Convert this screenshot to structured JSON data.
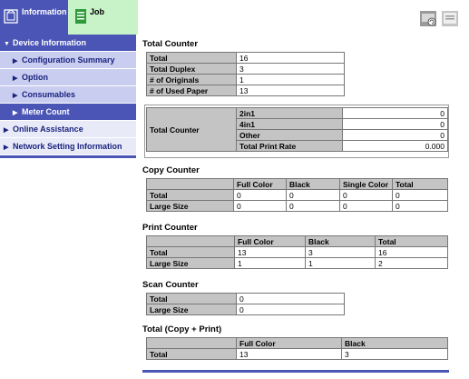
{
  "tabs": {
    "information": "Information",
    "job": "Job"
  },
  "sidebar": {
    "device_information": "Device Information",
    "configuration_summary": "Configuration Summary",
    "option": "Option",
    "consumables": "Consumables",
    "meter_count": "Meter Count",
    "online_assistance": "Online Assistance",
    "network_setting_information": "Network Setting Information"
  },
  "total_counter": {
    "title": "Total Counter",
    "rows": [
      {
        "label": "Total",
        "value": "16"
      },
      {
        "label": "Total Duplex",
        "value": "3"
      },
      {
        "label": "# of Originals",
        "value": "1"
      },
      {
        "label": "# of Used Paper",
        "value": "13"
      }
    ],
    "box_label": "Total Counter",
    "box_rows": [
      {
        "label": "2in1",
        "value": "0"
      },
      {
        "label": "4in1",
        "value": "0"
      },
      {
        "label": "Other",
        "value": "0"
      },
      {
        "label": "Total Print Rate",
        "value": "0.000"
      }
    ]
  },
  "copy_counter": {
    "title": "Copy Counter",
    "headers": [
      "Full Color",
      "Black",
      "Single Color",
      "Total"
    ],
    "rows": [
      {
        "label": "Total",
        "values": [
          "0",
          "0",
          "0",
          "0"
        ]
      },
      {
        "label": "Large Size",
        "values": [
          "0",
          "0",
          "0",
          "0"
        ]
      }
    ]
  },
  "print_counter": {
    "title": "Print Counter",
    "headers": [
      "Full Color",
      "Black",
      "Total"
    ],
    "rows": [
      {
        "label": "Total",
        "values": [
          "13",
          "3",
          "16"
        ]
      },
      {
        "label": "Large Size",
        "values": [
          "1",
          "1",
          "2"
        ]
      }
    ]
  },
  "scan_counter": {
    "title": "Scan Counter",
    "rows": [
      {
        "label": "Total",
        "value": "0"
      },
      {
        "label": "Large Size",
        "value": "0"
      }
    ]
  },
  "total_copy_print": {
    "title": "Total (Copy + Print)",
    "headers": [
      "Full Color",
      "Black"
    ],
    "rows": [
      {
        "label": "Total",
        "values": [
          "13",
          "3"
        ]
      }
    ]
  },
  "colors": {
    "accent": "#4a55b5",
    "sidebar_sub": "#c9cdf0",
    "job_tab": "#c8f2c8",
    "header_cell": "#c4c4c4"
  }
}
